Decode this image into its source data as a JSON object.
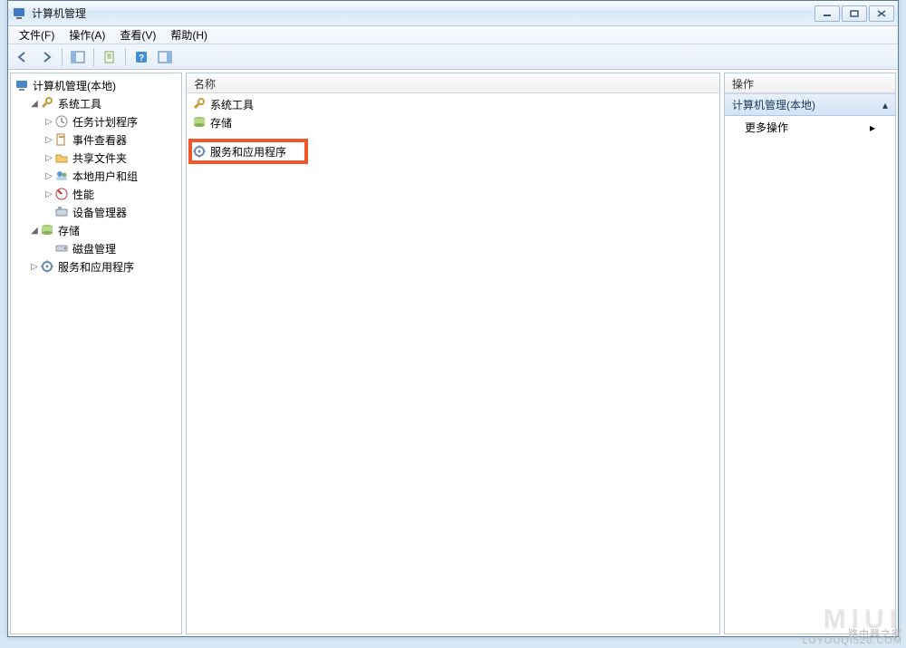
{
  "window": {
    "title": "计算机管理"
  },
  "menus": {
    "file": "文件(F)",
    "action": "操作(A)",
    "view": "查看(V)",
    "help": "帮助(H)"
  },
  "tree": {
    "root": "计算机管理(本地)",
    "system_tools": "系统工具",
    "task_scheduler": "任务计划程序",
    "event_viewer": "事件查看器",
    "shared_folders": "共享文件夹",
    "local_users": "本地用户和组",
    "performance": "性能",
    "device_manager": "设备管理器",
    "storage": "存储",
    "disk_management": "磁盘管理",
    "services_apps": "服务和应用程序"
  },
  "list": {
    "header_name": "名称",
    "items": {
      "system_tools": "系统工具",
      "storage": "存储",
      "services_apps": "服务和应用程序"
    }
  },
  "actions": {
    "header": "操作",
    "group": "计算机管理(本地)",
    "more": "更多操作"
  },
  "watermark": {
    "line1": "路由器之家",
    "line2": "LUYOUQI520.COM"
  }
}
